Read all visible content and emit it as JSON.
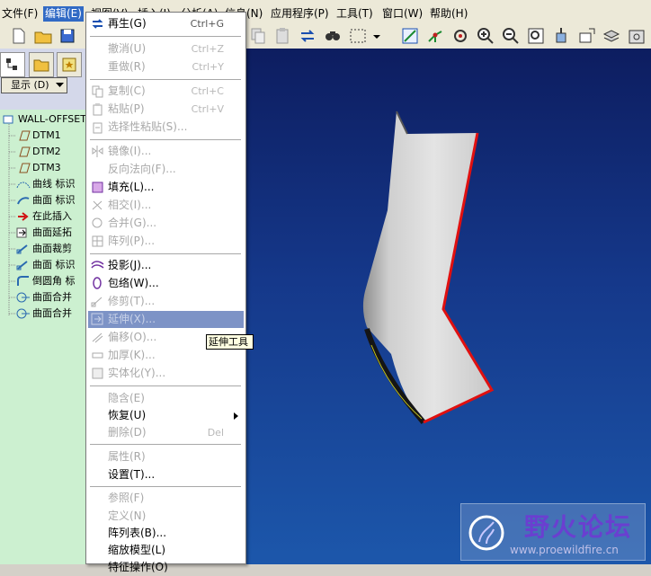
{
  "menubar": {
    "items": [
      "文件(F)",
      "编辑(E)",
      "视图(V)",
      "插入(I)",
      "分析(A)",
      "信息(N)",
      "应用程序(P)",
      "工具(T)",
      "窗口(W)",
      "帮助(H)"
    ]
  },
  "left_panel": {
    "show_button": "显示 (D)",
    "tree": [
      "WALL-OFFSET.P",
      "DTM1",
      "DTM2",
      "DTM3",
      "曲线 标识",
      "曲面 标识",
      "在此插入",
      "曲面延拓",
      "曲面裁剪",
      "曲面 标识",
      "倒圆角 标",
      "曲面合并",
      "曲面合并"
    ]
  },
  "edit_menu": {
    "items": [
      {
        "label": "再生(G)",
        "shortcut": "Ctrl+G",
        "icon": "regenerate-icon"
      },
      {
        "label": "撤消(U)",
        "shortcut": "Ctrl+Z",
        "icon": ""
      },
      {
        "label": "重做(R)",
        "shortcut": "Ctrl+Y",
        "icon": ""
      },
      {
        "label": "复制(C)",
        "shortcut": "Ctrl+C",
        "icon": "copy-icon"
      },
      {
        "label": "粘贴(P)",
        "shortcut": "Ctrl+V",
        "icon": "paste-icon"
      },
      {
        "label": "选择性粘贴(S)...",
        "shortcut": "",
        "icon": "paste-special-icon"
      },
      {
        "label": "镜像(I)...",
        "shortcut": "",
        "icon": "mirror-icon"
      },
      {
        "label": "反向法向(F)...",
        "shortcut": "",
        "icon": ""
      },
      {
        "label": "填充(L)...",
        "shortcut": "",
        "icon": "fill-icon"
      },
      {
        "label": "相交(I)...",
        "shortcut": "",
        "icon": "intersect-icon"
      },
      {
        "label": "合并(G)...",
        "shortcut": "",
        "icon": "merge-icon"
      },
      {
        "label": "阵列(P)...",
        "shortcut": "",
        "icon": "pattern-icon"
      },
      {
        "label": "投影(J)...",
        "shortcut": "",
        "icon": "project-icon"
      },
      {
        "label": "包络(W)...",
        "shortcut": "",
        "icon": "wrap-icon"
      },
      {
        "label": "修剪(T)...",
        "shortcut": "",
        "icon": "trim-icon"
      },
      {
        "label": "延伸(X)...",
        "shortcut": "",
        "icon": "extend-icon"
      },
      {
        "label": "偏移(O)...",
        "shortcut": "",
        "icon": "offset-icon"
      },
      {
        "label": "加厚(K)...",
        "shortcut": "",
        "icon": "thicken-icon"
      },
      {
        "label": "实体化(Y)...",
        "shortcut": "",
        "icon": "solidify-icon"
      },
      {
        "label": "隐含(E)",
        "shortcut": "",
        "icon": ""
      },
      {
        "label": "恢复(U)",
        "shortcut": "",
        "icon": ""
      },
      {
        "label": "删除(D)",
        "shortcut": "Del",
        "icon": ""
      },
      {
        "label": "属性(R)",
        "shortcut": "",
        "icon": ""
      },
      {
        "label": "设置(T)...",
        "shortcut": "",
        "icon": ""
      },
      {
        "label": "参照(F)",
        "shortcut": "",
        "icon": ""
      },
      {
        "label": "定义(N)",
        "shortcut": "",
        "icon": ""
      },
      {
        "label": "阵列表(B)...",
        "shortcut": "",
        "icon": ""
      },
      {
        "label": "缩放模型(L)",
        "shortcut": "",
        "icon": ""
      },
      {
        "label": "特征操作(O)",
        "shortcut": "",
        "icon": ""
      }
    ]
  },
  "tooltip": "延伸工具",
  "watermark": {
    "title": "野火论坛",
    "url": "www.proewildfire.cn"
  },
  "colors": {
    "menu_highlight": "#7d93c6",
    "tree_background": "#ccf0d0",
    "viewport_top": "#0d1d60",
    "viewport_bottom": "#1c57ab",
    "edge_highlight": "#e01010"
  }
}
